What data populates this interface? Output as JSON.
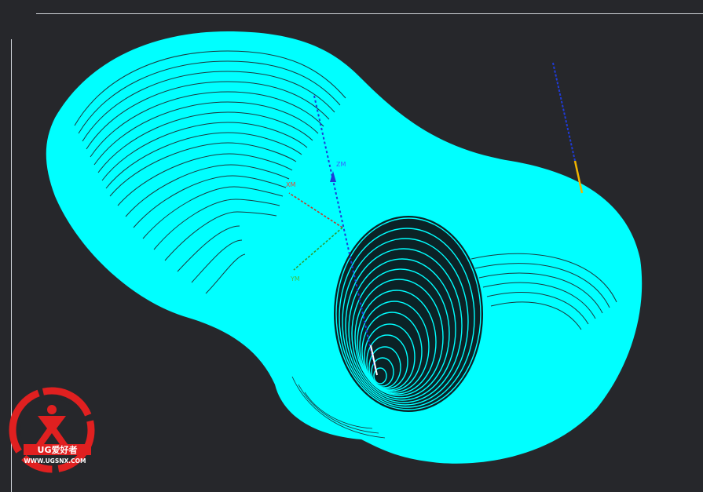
{
  "axes": {
    "zm_label": "ZM",
    "xm_label": "XM",
    "ym_label": "YM"
  },
  "watermark": {
    "brand": "UG爱好者",
    "url": "WWW.UGSNX.COM"
  },
  "colors": {
    "background": "#26272b",
    "toolpath": "#00ffff",
    "z_axis": "#1f3bd6",
    "x_axis": "#c0392b",
    "y_axis": "#2e9b34",
    "tool_holder": "#f0b400",
    "tool": "#1f3bd6",
    "watermark": "#e02020"
  }
}
